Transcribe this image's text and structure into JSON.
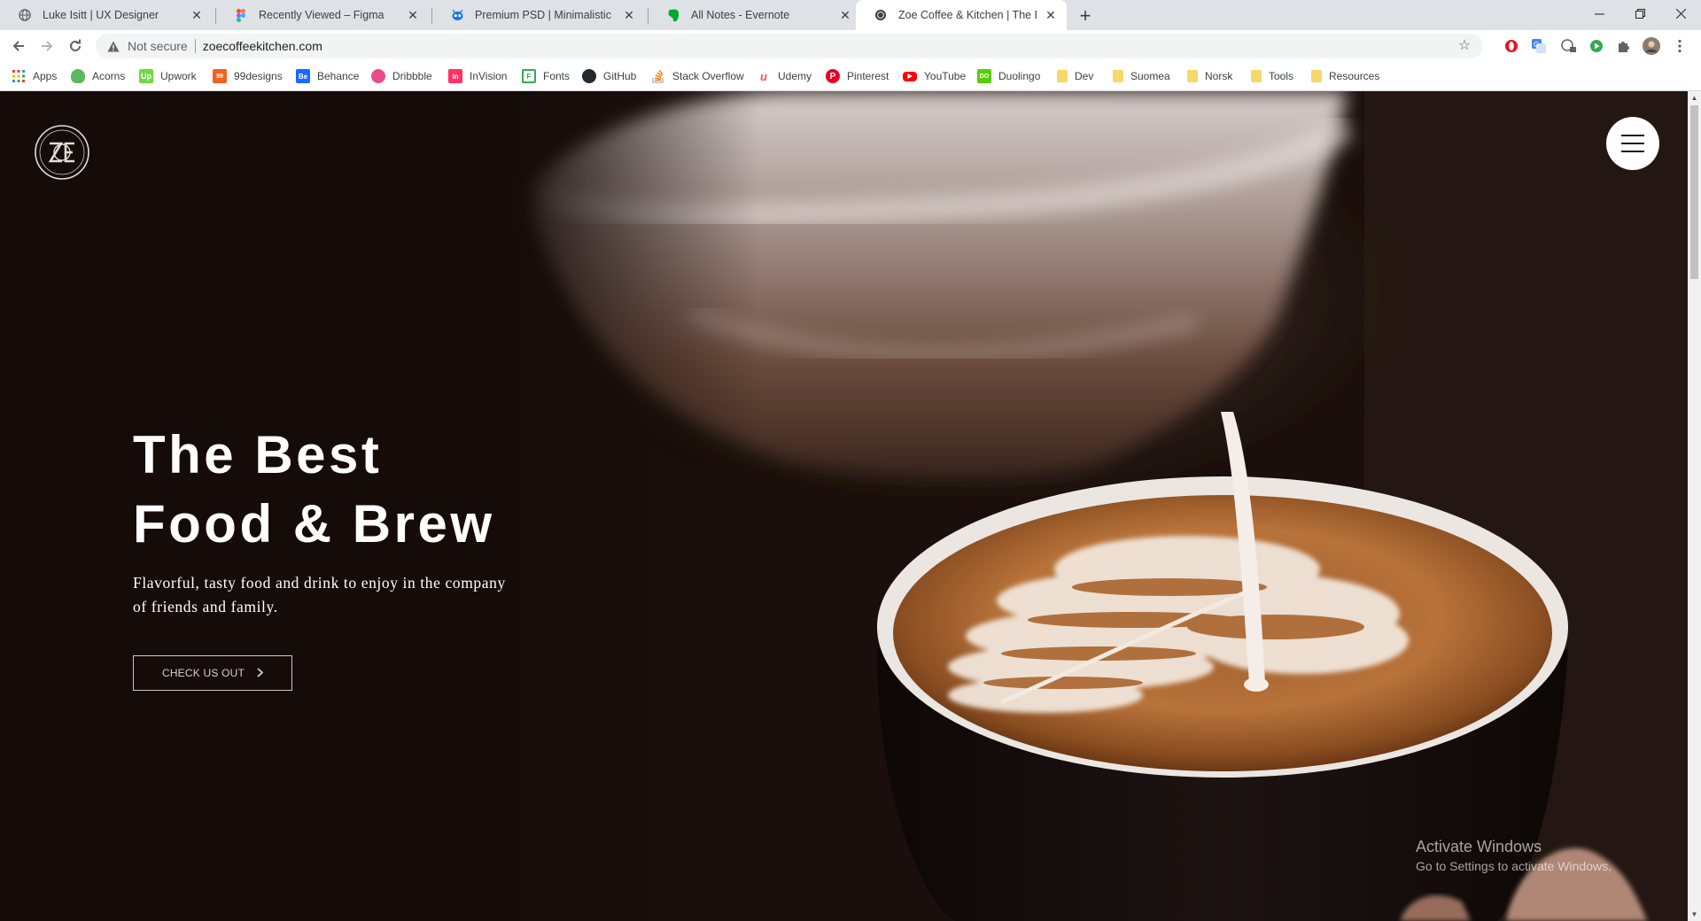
{
  "browser": {
    "tabs": [
      {
        "title": "Luke Isitt | UX Designer",
        "icon": "globe-icon",
        "active": false
      },
      {
        "title": "Recently Viewed – Figma",
        "icon": "figma-icon",
        "active": false
      },
      {
        "title": "Premium PSD | Minimalistic scene",
        "icon": "freepik-icon",
        "active": false
      },
      {
        "title": "All Notes - Evernote",
        "icon": "evernote-icon",
        "active": false
      },
      {
        "title": "Zoe Coffee & Kitchen | The Best Food",
        "icon": "globe-icon",
        "active": true
      }
    ],
    "new_tab_symbol": "+",
    "address": {
      "security_label": "Not secure",
      "url": "zoecoffeekitchen.com"
    },
    "bookmarks": [
      {
        "label": "Apps",
        "icon": "apps-grid-icon",
        "color": "#ea4335"
      },
      {
        "label": "Acorns",
        "icon": "acorns-icon",
        "color": "#5cb85c"
      },
      {
        "label": "Upwork",
        "icon": "upwork-icon",
        "color": "#6fda44"
      },
      {
        "label": "99designs",
        "icon": "99designs-icon",
        "color": "#f26322"
      },
      {
        "label": "Behance",
        "icon": "behance-icon",
        "color": "#1769ff"
      },
      {
        "label": "Dribbble",
        "icon": "dribbble-icon",
        "color": "#ea4c89"
      },
      {
        "label": "InVision",
        "icon": "invision-icon",
        "color": "#ff3366"
      },
      {
        "label": "Fonts",
        "icon": "fonts-icon",
        "color": "#34a853"
      },
      {
        "label": "GitHub",
        "icon": "github-icon",
        "color": "#24292e"
      },
      {
        "label": "Stack Overflow",
        "icon": "stackoverflow-icon",
        "color": "#f48024"
      },
      {
        "label": "Udemy",
        "icon": "udemy-icon",
        "color": "#ec5252"
      },
      {
        "label": "Pinterest",
        "icon": "pinterest-icon",
        "color": "#e60023"
      },
      {
        "label": "YouTube",
        "icon": "youtube-icon",
        "color": "#ff0000"
      },
      {
        "label": "Duolingo",
        "icon": "duolingo-icon",
        "color": "#58cc02"
      },
      {
        "label": "Dev",
        "icon": "folder-icon",
        "color": "#f6d86b"
      },
      {
        "label": "Suomea",
        "icon": "folder-icon",
        "color": "#f6d86b"
      },
      {
        "label": "Norsk",
        "icon": "folder-icon",
        "color": "#f6d86b"
      },
      {
        "label": "Tools",
        "icon": "folder-icon",
        "color": "#f6d86b"
      },
      {
        "label": "Resources",
        "icon": "folder-icon",
        "color": "#f6d86b"
      }
    ]
  },
  "hero": {
    "title_line1": "The Best",
    "title_line2": "Food & Brew",
    "subtitle": "Flavorful, tasty food and drink to enjoy in the company of friends and family.",
    "cta_label": "CHECK US OUT",
    "cta_icon": "chevron-right-icon"
  },
  "watermark": {
    "line1": "Activate Windows",
    "line2": "Go to Settings to activate Windows."
  }
}
